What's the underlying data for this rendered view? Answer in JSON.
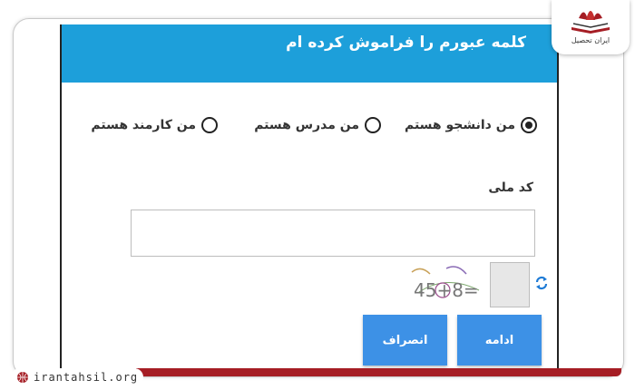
{
  "dialog": {
    "title": "کلمه عبورم را فراموش کرده ام"
  },
  "role_options": [
    {
      "label": "من دانشجو هستم",
      "selected": true
    },
    {
      "label": "من مدرس هستم",
      "selected": false
    },
    {
      "label": "من کارمند هستم",
      "selected": false
    }
  ],
  "national_code": {
    "label": "کد ملی",
    "value": ""
  },
  "captcha": {
    "text": "45+8=",
    "answer": ""
  },
  "buttons": {
    "continue": "ادامه",
    "cancel": "انصراف"
  },
  "watermark": {
    "site": "irantahsil.org",
    "logo_text": "ایران تحصیل"
  },
  "colors": {
    "header": "#1d9fda",
    "button": "#3d91e6",
    "brand": "#a51d24"
  }
}
